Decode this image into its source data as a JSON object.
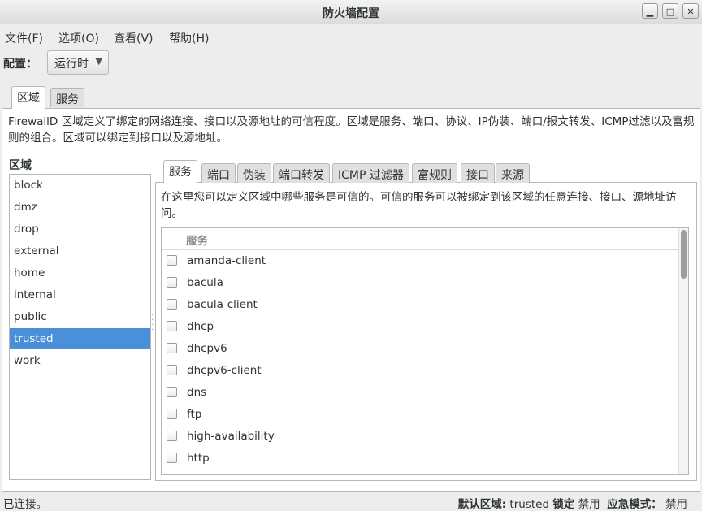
{
  "window": {
    "title": "防火墙配置",
    "btn_min": "▁",
    "btn_max": "□",
    "btn_close": "✕"
  },
  "menu": [
    {
      "label": "文件(F)"
    },
    {
      "label": "选项(O)"
    },
    {
      "label": "查看(V)"
    },
    {
      "label": "帮助(H)"
    }
  ],
  "config": {
    "label": "配置：",
    "value": "运行时"
  },
  "top_tabs": [
    {
      "label": "区域",
      "active": true
    },
    {
      "label": "服务",
      "active": false
    }
  ],
  "zones": {
    "description": "FirewallD 区域定义了绑定的网络连接、接口以及源地址的可信程度。区域是服务、端口、协议、IP伪装、端口/报文转发、ICMP过滤以及富规则的组合。区域可以绑定到接口以及源地址。",
    "heading": "区域",
    "items": [
      "block",
      "dmz",
      "drop",
      "external",
      "home",
      "internal",
      "public",
      "trusted",
      "work"
    ],
    "selected": "trusted"
  },
  "inner_tabs": [
    {
      "label": "服务",
      "active": true
    },
    {
      "label": "端口",
      "active": false
    },
    {
      "label": "伪装",
      "active": false
    },
    {
      "label": "端口转发",
      "active": false
    },
    {
      "label": "ICMP 过滤器",
      "active": false
    },
    {
      "label": "富规则",
      "active": false
    },
    {
      "label": "接口",
      "active": false
    },
    {
      "label": "来源",
      "active": false
    }
  ],
  "services": {
    "description": "在这里您可以定义区域中哪些服务是可信的。可信的服务可以被绑定到该区域的任意连接、接口、源地址访问。",
    "column_header": "服务",
    "rows": [
      "amanda-client",
      "bacula",
      "bacula-client",
      "dhcp",
      "dhcpv6",
      "dhcpv6-client",
      "dns",
      "ftp",
      "high-availability",
      "http"
    ]
  },
  "status": {
    "left": "已连接。",
    "default_zone_label": "默认区域:",
    "default_zone_value": "trusted",
    "lock_label": "锁定",
    "lock_value": "禁用",
    "panic_label": "应急模式：",
    "panic_value": "禁用"
  },
  "colors": {
    "selection": "#4a90d9"
  }
}
